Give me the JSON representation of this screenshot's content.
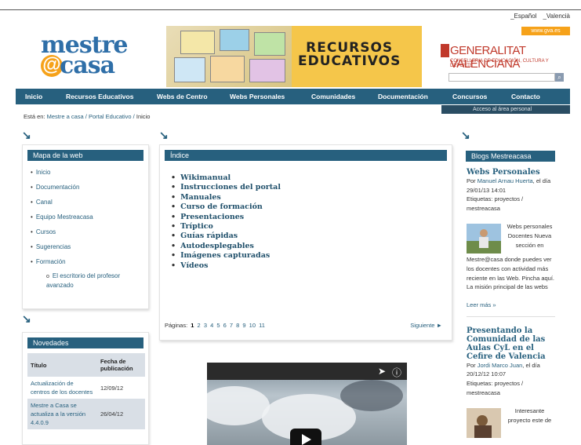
{
  "header": {
    "languages": [
      "_Español",
      "_Valencià"
    ],
    "logo_line1": "mestre",
    "logo_at": "@",
    "logo_line2": "casa",
    "banner_text_line1": "RECURSOS",
    "banner_text_line2": "EDUCATIVOS",
    "gva_web": "www.gva.es",
    "gva_name": "GENERALITAT VALENCIANA",
    "gva_sub": "CONSELLERIA DE EDUCACIÓN, CULTURA Y DEPORTE",
    "search_button": "⌕"
  },
  "nav": {
    "items": [
      "Inicio",
      "Recursos Educativos",
      "Webs de Centro",
      "Webs Personales",
      "Comunidades",
      "Documentación",
      "Concursos",
      "Contacto"
    ]
  },
  "personal_area": "Acceso al área personal",
  "breadcrumb": {
    "prefix": "Está en:",
    "path": "Mestre a casa / Portal Educativo /",
    "current": "Inicio"
  },
  "mapa": {
    "title": "Mapa de la web",
    "items": [
      "Inicio",
      "Documentación",
      "Canal",
      "Equipo Mestreacasa",
      "Cursos",
      "Sugerencias",
      "Formación"
    ],
    "subitem": "El escritorio del profesor avanzado"
  },
  "indice": {
    "title": "Índice",
    "items": [
      "Wikimanual",
      "Instrucciones del portal",
      "Manuales",
      "Curso de formación",
      "Presentaciones",
      "Tríptico",
      "Guías rápidas",
      "Autodesplegables",
      "Imágenes capturadas",
      "Vídeos"
    ],
    "pages_label": "Páginas:",
    "current_page": "1",
    "pages": [
      "2",
      "3",
      "4",
      "5",
      "6",
      "7",
      "8",
      "9",
      "10",
      "11"
    ],
    "next": "Siguiente"
  },
  "novedades": {
    "title": "Novedades",
    "col_title": "Título",
    "col_date": "Fecha de publicación",
    "rows": [
      {
        "title": "Actualización de centros de los docentes",
        "date": "12/09/12"
      },
      {
        "title": "Mestre a Casa se actualiza a la versión 4.4.0.9",
        "date": "26/04/12"
      }
    ]
  },
  "blogs": {
    "title": "Blogs Mestreacasa",
    "post1": {
      "title": "Webs Personales",
      "meta_prefix": "Por",
      "author": "Manuel Arnau Huerta",
      "meta_rest": ", el día 29/01/13 14:01",
      "tags": "Etiquetas: proyectos / mestreacasa",
      "body_wrap": "Webs personales Docentes Nueva sección en",
      "body": "Mestre@casa donde puedes ver los docentes con actividad más reciente en las Web. Pincha aquí.   La misión principal de las webs",
      "more": "Leer más »"
    },
    "post2": {
      "title": "Presentando la Comunidad de las Aulas CyL en el Cefire de Valencia",
      "meta_prefix": "Por",
      "author": "Jordi Marco Juan",
      "meta_rest": ", el día 20/12/12 10:07",
      "tags": "Etiquetas: proyectos / mestreacasa",
      "body_wrap": "Interesante proyecto este de"
    }
  },
  "colors": {
    "nav": "#27607e",
    "accent": "#f6a21a",
    "gva_red": "#c0392b"
  }
}
